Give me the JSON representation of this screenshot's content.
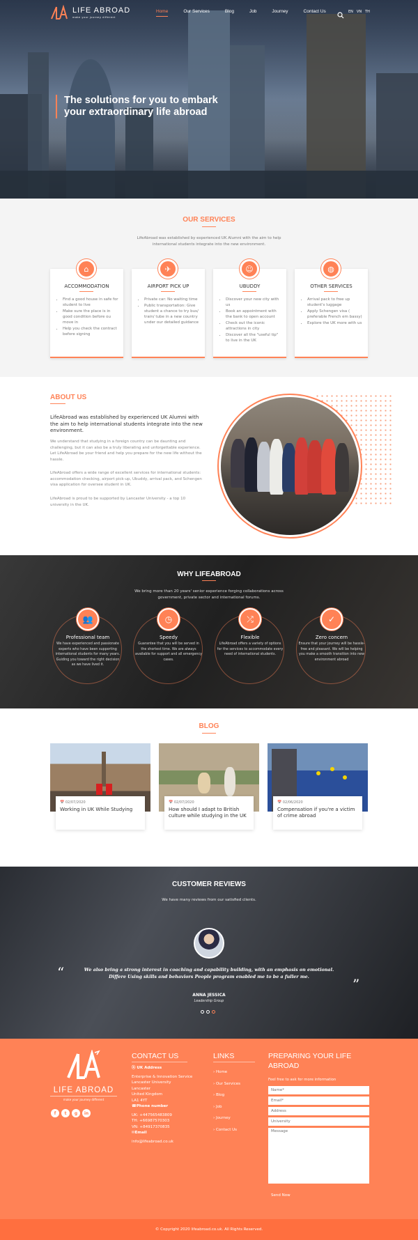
{
  "nav": {
    "logo_text": "LIFE ABROAD",
    "logo_sub": "make your journey different",
    "links": [
      "Home",
      "Our Services",
      "Blog",
      "Job",
      "Journey",
      "Contact Us"
    ],
    "active": "Home",
    "languages": [
      "EN",
      "VN",
      "TH"
    ]
  },
  "hero": {
    "headline": "The solutions for you to embark your extraordinary life abroad"
  },
  "services": {
    "title": "OUR SERVICES",
    "description": "LifeAbroad was established by experienced UK Alumni with the aim to help international students integrate into the new environment.",
    "cards": [
      {
        "title": "ACCOMMODATION",
        "icon": "house-icon",
        "items": [
          "Find a good house in safe for student to live",
          "Make sure the place is in good condition before ou move in",
          "Help you check the contract before signing"
        ]
      },
      {
        "title": "AIRPORT PICK UP",
        "icon": "airplane-icon",
        "items": [
          "Private car: No waiting time",
          "Public transportation: Give student a chance to try bus/ train/ tube in a new country under our detailed guidance"
        ]
      },
      {
        "title": "UBUDDY",
        "icon": "buddy-icon",
        "items": [
          "Discover your new city with us",
          "Book an appointment with the bank to open account",
          "Check out the iconic attractions in city",
          "Discover all the \"useful tip\" to live in the UK"
        ]
      },
      {
        "title": "OTHER SERVICES",
        "icon": "globe-icon",
        "items": [
          "Arrival pack to free up student's luggage",
          "Apply Schengen visa ( preferable French em bassy)",
          "Explore the UK more with us"
        ]
      }
    ]
  },
  "about": {
    "title": "ABOUT US",
    "lead": "LifeAbroad was established by experienced UK Alumni with the aim to help international students integrate into the new environment.",
    "paragraphs": [
      "We understand that studying in a foreign country can be daunting and challenging, but it can also be a truly liberating and unforgettable experience. Let LifeAbroad be your friend and help you prepare for the new life without the hassle.",
      "LifeAbroad offers a wide range of excellent services for international students: accommodation checking, airport pick-up, Ubuddy, arrival pack, and Schengen visa application for oversee student in UK.",
      "LifeAbroad is proud to be supported by Lancaster University - a top 10 university in the UK."
    ]
  },
  "why": {
    "title": "WHY LIFEABROAD",
    "description": "We bring more than 20 years' senior experience forging collaborations across government, private sector and international forums.",
    "items": [
      {
        "title": "Professional team",
        "icon": "team-icon",
        "text": "We have experienced and passionate experts who have been supporting international students for many years. Guiding you toward the right decision as we have lived it."
      },
      {
        "title": "Speedy",
        "icon": "speed-icon",
        "text": "Guarantee that you will be served in the shortest time. We are always available for support and all emergency cases."
      },
      {
        "title": "Flexible",
        "icon": "shuffle-icon",
        "text": "LifeAbroad offers a variety of options for the services to accommodate every need of international students."
      },
      {
        "title": "Zero concern",
        "icon": "check-icon",
        "text": "Ensure that your journey will be hassle-free and pleasant. We will be helping you make a smooth transition into new environment abroad"
      }
    ]
  },
  "blog": {
    "title": "BLOG",
    "posts": [
      {
        "date": "02/07/2020",
        "title": "Working in UK While Studying"
      },
      {
        "date": "02/07/2020",
        "title": "How should I adapt to British culture while studying in the UK"
      },
      {
        "date": "02/06/2020",
        "title": "Compensation if you're a victim of crime abroad"
      }
    ]
  },
  "reviews": {
    "title": "CUSTOMER REVIEWS",
    "description": "We have many reviews from our satisfied clients.",
    "quote": "We also bring a strong interest in coaching and capability building, with an emphasis on emotional. Differe Using skills and behaviors People program enabled me to be a fuller me.",
    "name": "ANNA JESSICA",
    "role": "Leadership Group"
  },
  "footer": {
    "logo_text": "LIFE ABROAD",
    "logo_sub": "make your journey different",
    "socials": [
      "f",
      "t",
      "g",
      "in"
    ],
    "contact_title": "CONTACT US",
    "address_label": "UK Address",
    "address_lines": [
      "Enterprise & Innovation Service",
      "Lancaster University",
      "Lancaster",
      "United Kingdom",
      "LA1 4YT"
    ],
    "phone_label": "Phone number",
    "phones": [
      "UK: +447565483809",
      "TH: +66987570303",
      "VN: +84917370835"
    ],
    "email_label": "Email",
    "email": "info@lifeabroad.co.uk",
    "links_title": "LINKS",
    "links": [
      "Home",
      "Our Services",
      "Blog",
      "Job",
      "Journey",
      "Contact Us"
    ],
    "form_title": "PREPARING YOUR LIFE ABROAD",
    "form_hint": "Feel free to ask for more information",
    "fields": {
      "name": "Name*",
      "email": "Email*",
      "address": "Address",
      "university": "University",
      "message": "Message"
    },
    "send_label": "Send Now",
    "copyright": "© Copyright 2020 lifeabroad.co.uk. All Rights Reserved."
  },
  "colors": {
    "accent": "#ff8256",
    "footer": "#ff8256",
    "bottom_bar": "#ff6f3f"
  }
}
